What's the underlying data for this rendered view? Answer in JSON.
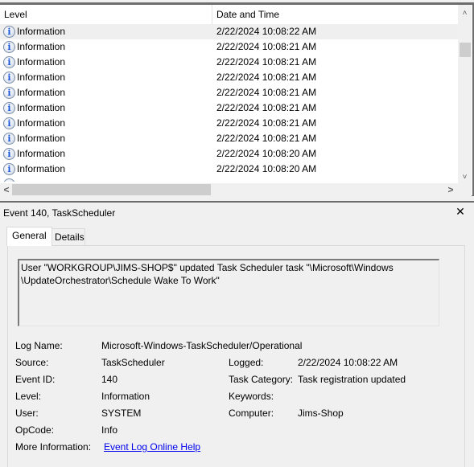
{
  "list": {
    "columns": {
      "level": "Level",
      "date": "Date and Time"
    },
    "rows": [
      {
        "level": "Information",
        "date": "2/22/2024 10:08:22 AM",
        "selected": true
      },
      {
        "level": "Information",
        "date": "2/22/2024 10:08:21 AM"
      },
      {
        "level": "Information",
        "date": "2/22/2024 10:08:21 AM"
      },
      {
        "level": "Information",
        "date": "2/22/2024 10:08:21 AM"
      },
      {
        "level": "Information",
        "date": "2/22/2024 10:08:21 AM"
      },
      {
        "level": "Information",
        "date": "2/22/2024 10:08:21 AM"
      },
      {
        "level": "Information",
        "date": "2/22/2024 10:08:21 AM"
      },
      {
        "level": "Information",
        "date": "2/22/2024 10:08:21 AM"
      },
      {
        "level": "Information",
        "date": "2/22/2024 10:08:20 AM"
      },
      {
        "level": "Information",
        "date": "2/22/2024 10:08:20 AM"
      }
    ],
    "icon": "info-icon",
    "icon_glyph": "i",
    "scroll": {
      "up": "˄",
      "down": "˅",
      "left": "<",
      "right": ">"
    }
  },
  "detail": {
    "title": "Event 140, TaskScheduler",
    "close_glyph": "✕",
    "tabs": [
      {
        "label": "General",
        "active": true
      },
      {
        "label": "Details",
        "active": false
      }
    ],
    "description_line1": "User \"WORKGROUP\\JIMS-SHOP$\"  updated Task Scheduler task \"\\Microsoft\\Windows",
    "description_line2": "\\UpdateOrchestrator\\Schedule Wake To Work\"",
    "fields": {
      "log_name": {
        "label": "Log Name:",
        "value": "Microsoft-Windows-TaskScheduler/Operational"
      },
      "source": {
        "label": "Source:",
        "value": "TaskScheduler"
      },
      "logged": {
        "label": "Logged:",
        "value": "2/22/2024 10:08:22 AM"
      },
      "event_id": {
        "label": "Event ID:",
        "value": "140"
      },
      "task_category": {
        "label": "Task Category:",
        "value": "Task registration updated"
      },
      "level": {
        "label": "Level:",
        "value": "Information"
      },
      "keywords": {
        "label": "Keywords:",
        "value": ""
      },
      "user": {
        "label": "User:",
        "value": "SYSTEM"
      },
      "computer": {
        "label": "Computer:",
        "value": "Jims-Shop"
      },
      "opcode": {
        "label": "OpCode:",
        "value": "Info"
      },
      "more_info": {
        "label": "More Information:",
        "value": "Event Log Online Help"
      }
    }
  }
}
